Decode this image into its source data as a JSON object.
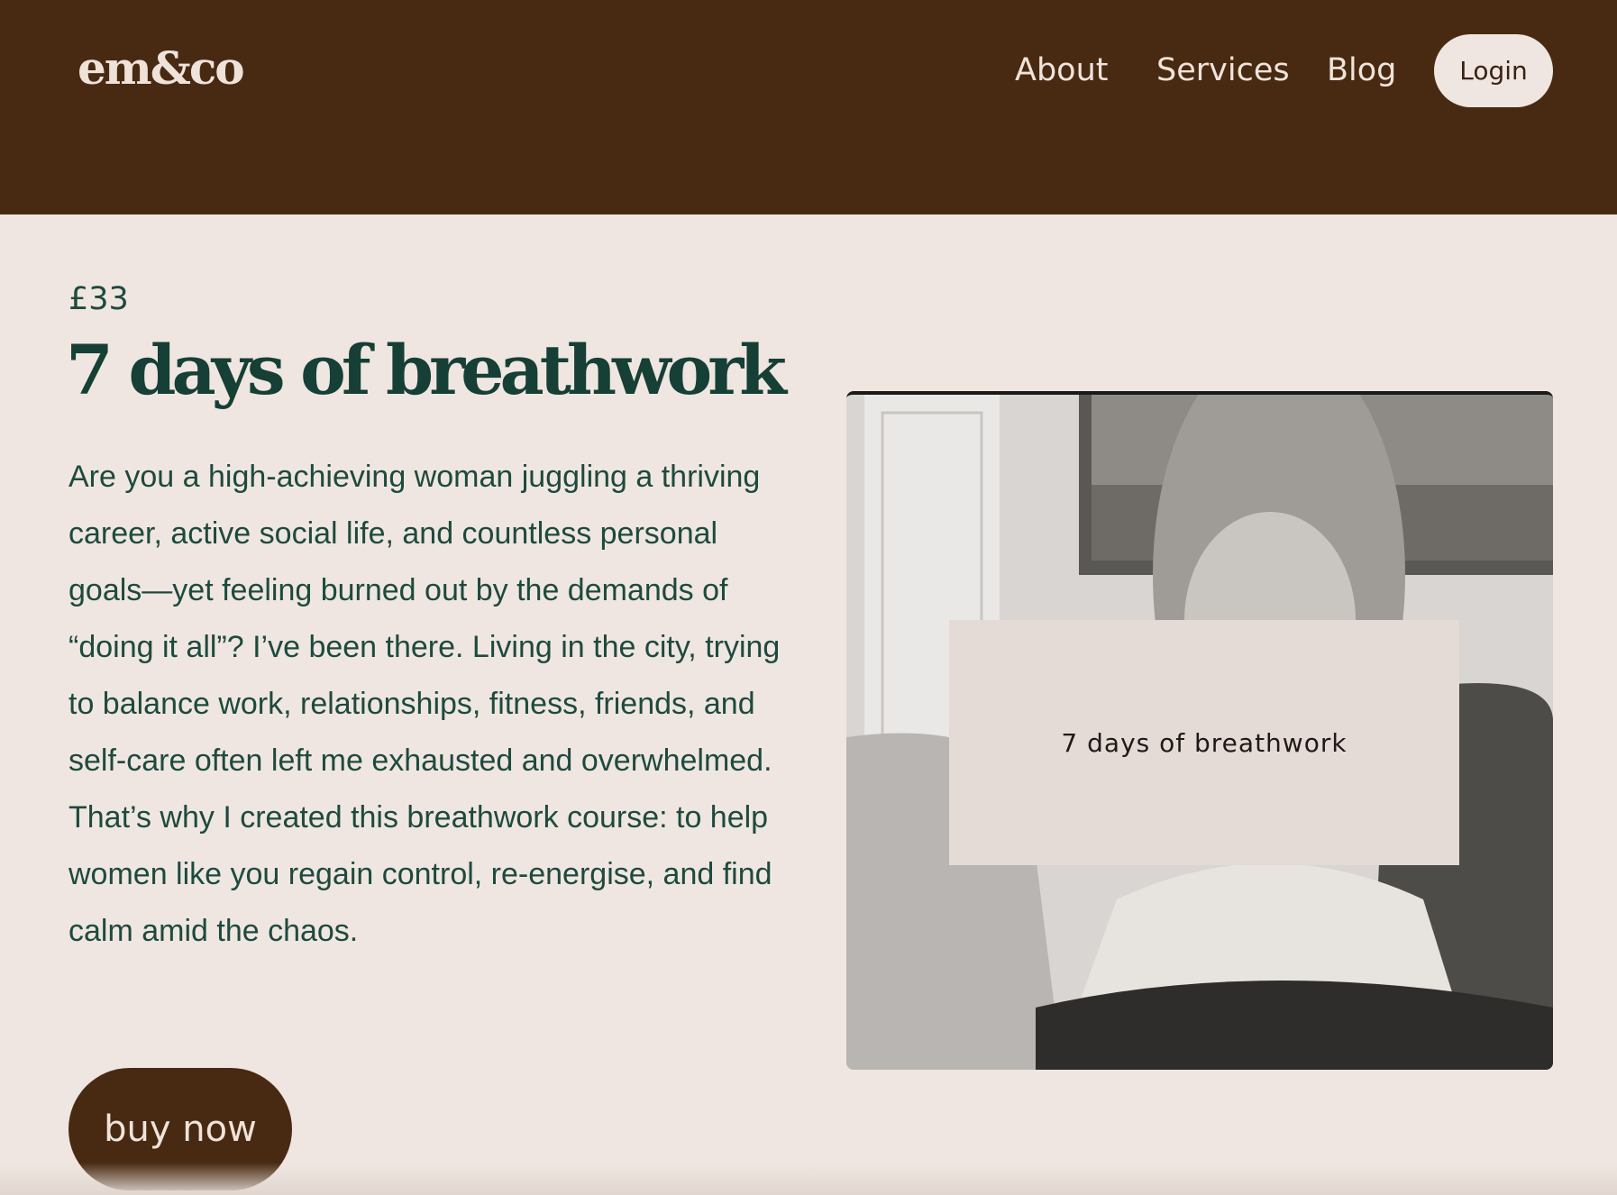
{
  "header": {
    "logo": "em&co",
    "nav": [
      {
        "label": "About"
      },
      {
        "label": "Services"
      },
      {
        "label": "Blog"
      }
    ],
    "login_label": "Login"
  },
  "product": {
    "price": "£33",
    "title": "7 days of breathwork",
    "description": "Are you a high-achieving woman juggling a thriving career, active social life, and countless personal goals—yet feeling burned out by the demands of “doing it all”? I’ve been there. Living in the city, trying to balance work, relationships, fitness, friends, and self-care often left me exhausted and overwhelmed. That’s why I created this breathwork course: to help women like you regain control, re-energise, and find calm amid the chaos.",
    "buy_label": "buy now",
    "video_card_title": "7 days of breathwork"
  },
  "colors": {
    "header_bg": "#482A12",
    "page_bg": "#F0E6E1",
    "title_green": "#163F35",
    "text_green": "#1E4A3E"
  }
}
